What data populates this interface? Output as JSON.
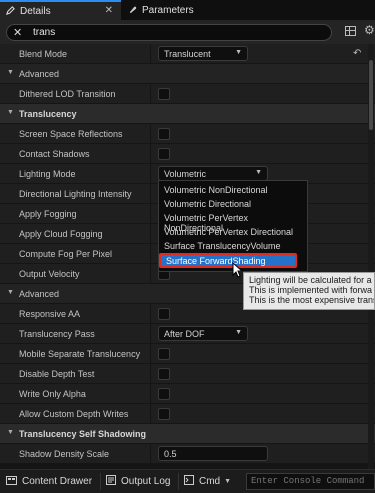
{
  "tabs": [
    {
      "label": "Details",
      "icon": "pencil-icon",
      "active": true
    },
    {
      "label": "Parameters",
      "icon": "brush-icon",
      "active": false
    }
  ],
  "search": {
    "value": "trans"
  },
  "rows": [
    {
      "kind": "prop",
      "label": "Blend Mode",
      "control": "dropdown",
      "value": "Translucent",
      "reset": true
    },
    {
      "kind": "sub",
      "label": "Advanced"
    },
    {
      "kind": "prop",
      "label": "Dithered LOD Transition",
      "control": "checkbox"
    },
    {
      "kind": "cat",
      "label": "Translucency"
    },
    {
      "kind": "prop",
      "label": "Screen Space Reflections",
      "control": "checkbox"
    },
    {
      "kind": "prop",
      "label": "Contact Shadows",
      "control": "checkbox"
    },
    {
      "kind": "prop",
      "label": "Lighting Mode",
      "control": "dropdown",
      "value": "Volumetric NonDirectional"
    },
    {
      "kind": "prop",
      "label": "Directional Lighting Intensity",
      "control": "none"
    },
    {
      "kind": "prop",
      "label": "Apply Fogging",
      "control": "none"
    },
    {
      "kind": "prop",
      "label": "Apply Cloud Fogging",
      "control": "none"
    },
    {
      "kind": "prop",
      "label": "Compute Fog Per Pixel",
      "control": "none"
    },
    {
      "kind": "prop",
      "label": "Output Velocity",
      "control": "checkbox"
    },
    {
      "kind": "sub",
      "label": "Advanced"
    },
    {
      "kind": "prop",
      "label": "Responsive AA",
      "control": "checkbox"
    },
    {
      "kind": "prop",
      "label": "Translucency Pass",
      "control": "dropdown",
      "value": "After DOF"
    },
    {
      "kind": "prop",
      "label": "Mobile Separate Translucency",
      "control": "checkbox"
    },
    {
      "kind": "prop",
      "label": "Disable Depth Test",
      "control": "checkbox"
    },
    {
      "kind": "prop",
      "label": "Write Only Alpha",
      "control": "checkbox"
    },
    {
      "kind": "prop",
      "label": "Allow Custom Depth Writes",
      "control": "checkbox"
    },
    {
      "kind": "cat",
      "label": "Translucency Self Shadowing"
    },
    {
      "kind": "prop",
      "label": "Shadow Density Scale",
      "control": "number",
      "value": "0.5"
    }
  ],
  "lighting_mode_options": [
    "Volumetric NonDirectional",
    "Volumetric Directional",
    "Volumetric PerVertex NonDirectional",
    "Volumetric PerVertex Directional",
    "Surface TranslucencyVolume",
    "Surface ForwardShading"
  ],
  "selected_option_index": 5,
  "tooltip": [
    "Lighting will be calculated for a",
    "This is implemented with forwa",
    "This is the most expensive trans"
  ],
  "bottom": {
    "content_drawer": "Content Drawer",
    "output_log": "Output Log",
    "cmd": "Cmd",
    "console_placeholder": "Enter Console Command"
  },
  "colors": {
    "accent": "#2e8cf0",
    "selection": "#2572c9",
    "highlight_border": "#e02a20"
  }
}
